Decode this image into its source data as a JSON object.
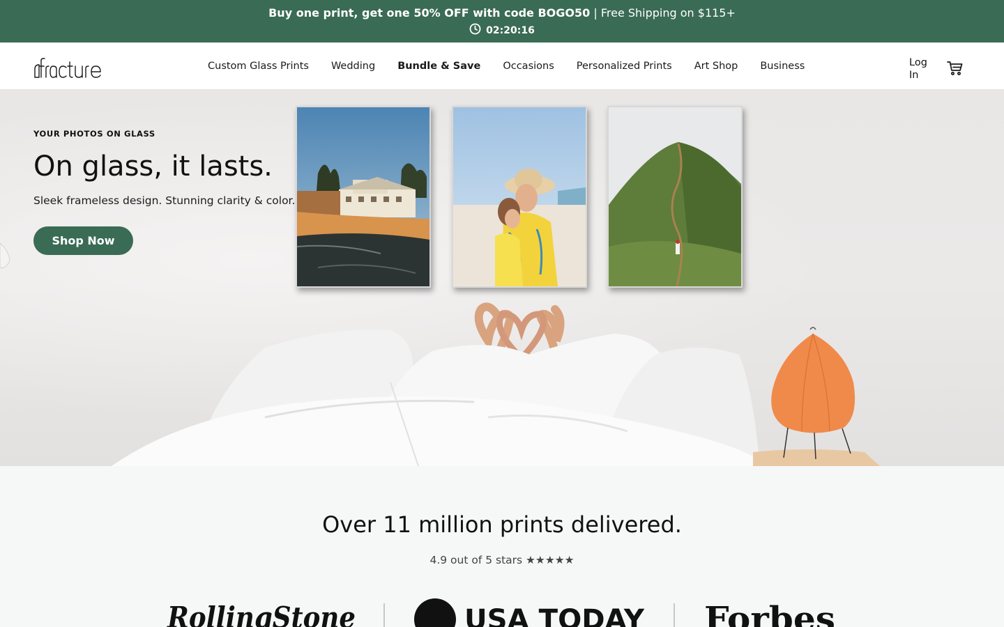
{
  "promo": {
    "bold_text": "Buy one print, get one 50% OFF with code BOGO50",
    "separator": " | ",
    "regular_text": "Free Shipping on $115+",
    "timer": "02:20:16"
  },
  "nav": {
    "logo_text": "fracture",
    "items": [
      {
        "label": "Custom Glass Prints"
      },
      {
        "label": "Wedding"
      },
      {
        "label": "Bundle & Save"
      },
      {
        "label": "Occasions"
      },
      {
        "label": "Personalized Prints"
      },
      {
        "label": "Art Shop"
      },
      {
        "label": "Business"
      }
    ],
    "login_label": "Log In",
    "cart_icon": "cart-icon"
  },
  "hero": {
    "eyebrow": "YOUR PHOTOS ON GLASS",
    "title": "On glass, it lasts.",
    "subtitle": "Sleek frameless design. Stunning clarity & color.",
    "cta_label": "Shop Now"
  },
  "stats": {
    "title": "Over 11 million prints delivered.",
    "rating": "4.9 out of 5 stars ★★★★★"
  },
  "press": {
    "logos": [
      "RollingStone",
      "USA TODAY",
      "Forbes"
    ]
  },
  "colors": {
    "brand_green": "#3a6b55",
    "lamp_orange": "#f08a4b"
  }
}
